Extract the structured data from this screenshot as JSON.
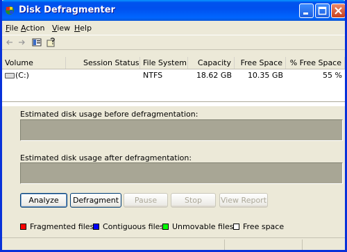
{
  "window": {
    "title": "Disk Defragmenter"
  },
  "menu": {
    "items": [
      {
        "first": "F",
        "rest": "ile"
      },
      {
        "first": "A",
        "rest": "ction"
      },
      {
        "first": "V",
        "rest": "iew"
      },
      {
        "first": "H",
        "rest": "elp"
      }
    ]
  },
  "toolbar": {
    "icons": [
      "back-arrow-icon",
      "forward-arrow-icon",
      "console-view-icon",
      "properties-help-icon"
    ]
  },
  "list": {
    "columns": [
      "Volume",
      "Session Status",
      "File System",
      "Capacity",
      "Free Space",
      "% Free Space"
    ],
    "rows": [
      {
        "volume": "(C:)",
        "status": "",
        "fs": "NTFS",
        "capacity": "18.62 GB",
        "free": "10.35 GB",
        "pct": "55 %"
      }
    ]
  },
  "panel": {
    "before_label": "Estimated disk usage before defragmentation:",
    "after_label": "Estimated disk usage after defragmentation:"
  },
  "buttons": {
    "analyze": "Analyze",
    "defragment": "Defragment",
    "pause": "Pause",
    "stop": "Stop",
    "view_report": "View Report"
  },
  "legend": {
    "fragmented": "Fragmented files",
    "contiguous": "Contiguous files",
    "unmovable": "Unmovable files",
    "free": "Free space"
  },
  "colors": {
    "fragmented": "#ff0000",
    "contiguous": "#0000ff",
    "unmovable": "#00ff00",
    "free": "#ffffff",
    "bar": "#a8a695"
  }
}
